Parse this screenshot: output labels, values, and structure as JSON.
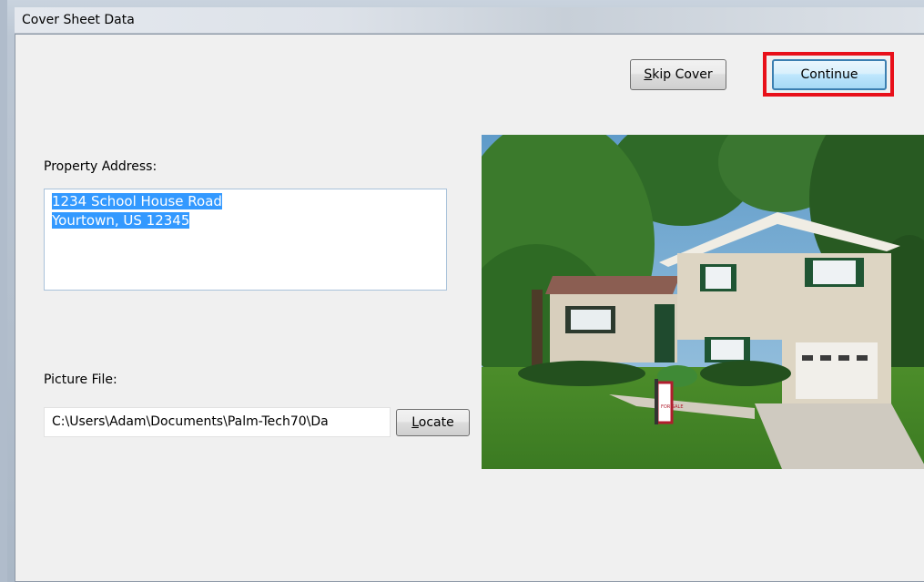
{
  "window": {
    "title": "Cover Sheet Data"
  },
  "buttons": {
    "skip_cover_label_u": "S",
    "skip_cover_label_rest": "kip Cover",
    "continue_label": "Continue",
    "locate_label_u": "L",
    "locate_label_rest": "ocate"
  },
  "form": {
    "property_address_label": "Property Address:",
    "address_line1": "1234 School House Road",
    "address_line2": "Yourtown, US 12345",
    "picture_file_label": "Picture File:",
    "picture_file_value": "C:\\Users\\Adam\\Documents\\Palm-Tech70\\Da"
  },
  "photo": {
    "icon": "house-photo",
    "sign_text": "FOR SALE"
  },
  "colors": {
    "highlight": "#e8101a",
    "selection": "#3399ff",
    "default_button_border": "#3c7fb1"
  }
}
